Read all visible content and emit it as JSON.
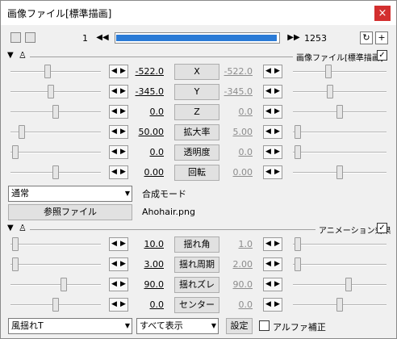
{
  "title": "画像ファイル[標準描画]",
  "close": "×",
  "frame": {
    "current": "1",
    "total": "1253",
    "progress": 0.99
  },
  "section1": {
    "name": "画像ファイル[標準描画]",
    "checked": true
  },
  "section2": {
    "name": "アニメーション効果",
    "checked": true
  },
  "tracks1": [
    {
      "label": "X",
      "left": "-522.0",
      "right": "-522.0",
      "lpos": 0.4,
      "rpos": 0.37
    },
    {
      "label": "Y",
      "left": "-345.0",
      "right": "-345.0",
      "lpos": 0.44,
      "rpos": 0.39
    },
    {
      "label": "Z",
      "left": "0.0",
      "right": "0.0",
      "lpos": 0.5,
      "rpos": 0.5
    },
    {
      "label": "拡大率",
      "left": "50.00",
      "right": "5.00",
      "lpos": 0.1,
      "rpos": 0.02
    },
    {
      "label": "透明度",
      "left": "0.0",
      "right": "0.0",
      "lpos": 0.02,
      "rpos": 0.02
    },
    {
      "label": "回転",
      "left": "0.00",
      "right": "0.00",
      "lpos": 0.5,
      "rpos": 0.5
    }
  ],
  "blend": {
    "value": "通常",
    "label": "合成モード"
  },
  "ref": {
    "button": "参照ファイル",
    "file": "Ahohair.png"
  },
  "tracks2": [
    {
      "label": "揺れ角",
      "left": "10.0",
      "right": "1.0",
      "lpos": 0.02,
      "rpos": 0.02
    },
    {
      "label": "揺れ周期",
      "left": "3.00",
      "right": "2.00",
      "lpos": 0.02,
      "rpos": 0.02
    },
    {
      "label": "揺れズレ",
      "left": "90.0",
      "right": "90.0",
      "lpos": 0.6,
      "rpos": 0.6
    },
    {
      "label": "センター",
      "left": "0.0",
      "right": "0.0",
      "lpos": 0.5,
      "rpos": 0.5
    }
  ],
  "bottom": {
    "effect": "風揺れT",
    "display": "すべて表示",
    "settings": "設定",
    "alpha": "アルファ補正"
  }
}
